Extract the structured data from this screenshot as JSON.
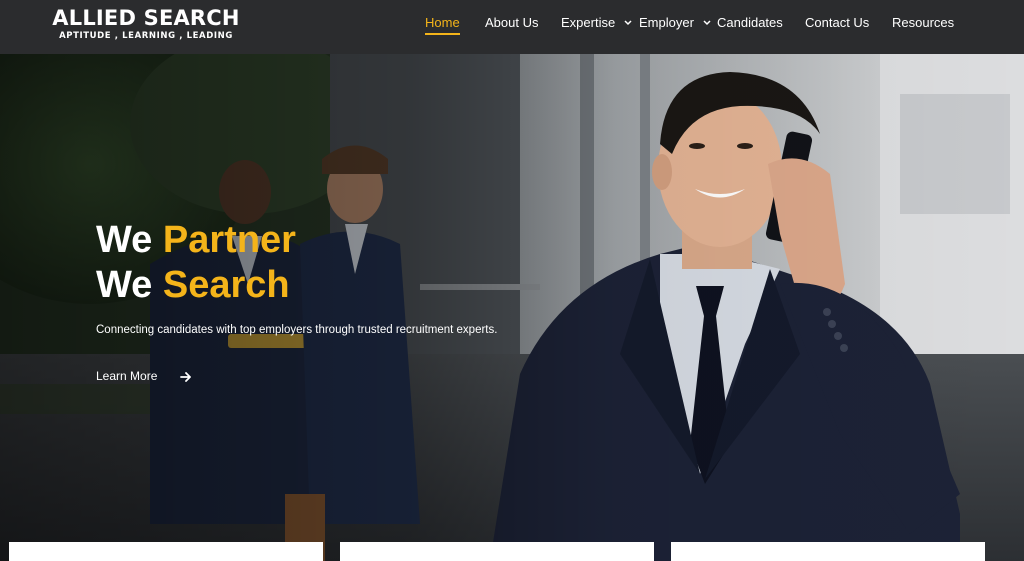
{
  "header": {
    "logo": {
      "name": "ALLIED SEARCH",
      "tagline": "APTITUDE , LEARNING , LEADING"
    },
    "nav": [
      {
        "label": "Home",
        "active": true,
        "dropdown": false
      },
      {
        "label": "About Us",
        "active": false,
        "dropdown": false
      },
      {
        "label": "Expertise",
        "active": false,
        "dropdown": true
      },
      {
        "label": "Employer",
        "active": false,
        "dropdown": true
      },
      {
        "label": "Candidates",
        "active": false,
        "dropdown": false
      },
      {
        "label": "Contact Us",
        "active": false,
        "dropdown": false
      },
      {
        "label": "Resources",
        "active": false,
        "dropdown": false
      }
    ]
  },
  "hero": {
    "line1_prefix": "We",
    "line1_accent": "Partner",
    "line2_prefix": "We",
    "line2_accent": "Search",
    "subtext": "Connecting candidates with top employers through trusted recruitment experts.",
    "cta_label": "Learn More",
    "cta_icon": "arrow-right-icon",
    "image": "professional-man-on-phone-with-colleagues-background"
  },
  "colors": {
    "accent": "#f4b41a",
    "header_bg": "#2b2c2e",
    "text_light": "#ffffff"
  }
}
